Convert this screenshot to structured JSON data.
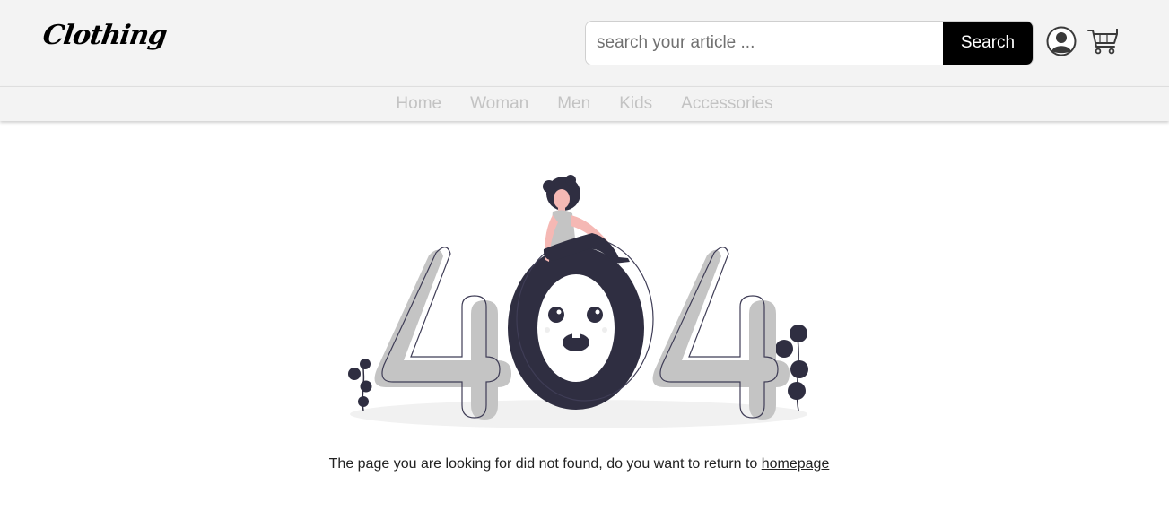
{
  "header": {
    "logo_text": "Clothing",
    "search": {
      "placeholder": "search your article ...",
      "button_label": "Search"
    },
    "icons": [
      "account-icon",
      "cart-icon"
    ]
  },
  "nav": {
    "items": [
      {
        "label": "Home"
      },
      {
        "label": "Woman"
      },
      {
        "label": "Men"
      },
      {
        "label": "Kids"
      },
      {
        "label": "Accessories"
      }
    ]
  },
  "error": {
    "illustration": "404-illustration",
    "message": "The page you are looking for did not found, do you want to return to",
    "link_label": "homepage"
  },
  "colors": {
    "header_bg": "#f3f3f3",
    "button_bg": "#000000",
    "nav_text": "#c3c3c3",
    "illustration_dark": "#2f2e41",
    "illustration_gray": "#c4c4c4",
    "skin": "#f5b8b4"
  }
}
